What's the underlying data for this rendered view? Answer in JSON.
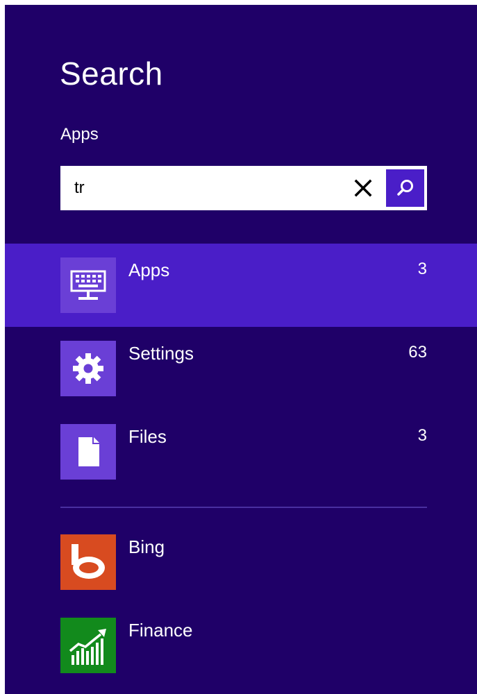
{
  "header": {
    "title": "Search",
    "scope": "Apps"
  },
  "search": {
    "value": "tr",
    "placeholder": ""
  },
  "results": [
    {
      "label": "Apps",
      "count": "3",
      "icon": "keyboard-monitor-icon",
      "selected": true,
      "tile_color": "#6a3fd6"
    },
    {
      "label": "Settings",
      "count": "63",
      "icon": "gear-icon",
      "selected": false,
      "tile_color": "#6a3fd6"
    },
    {
      "label": "Files",
      "count": "3",
      "icon": "file-icon",
      "selected": false,
      "tile_color": "#6a3fd6"
    }
  ],
  "apps": [
    {
      "label": "Bing",
      "icon": "bing-icon",
      "tile_color": "#d84b20"
    },
    {
      "label": "Finance",
      "icon": "finance-chart-icon",
      "tile_color": "#128a1c"
    }
  ],
  "colors": {
    "background": "#1f0068",
    "accent": "#4a1ec8",
    "tile": "#6a3fd6"
  }
}
